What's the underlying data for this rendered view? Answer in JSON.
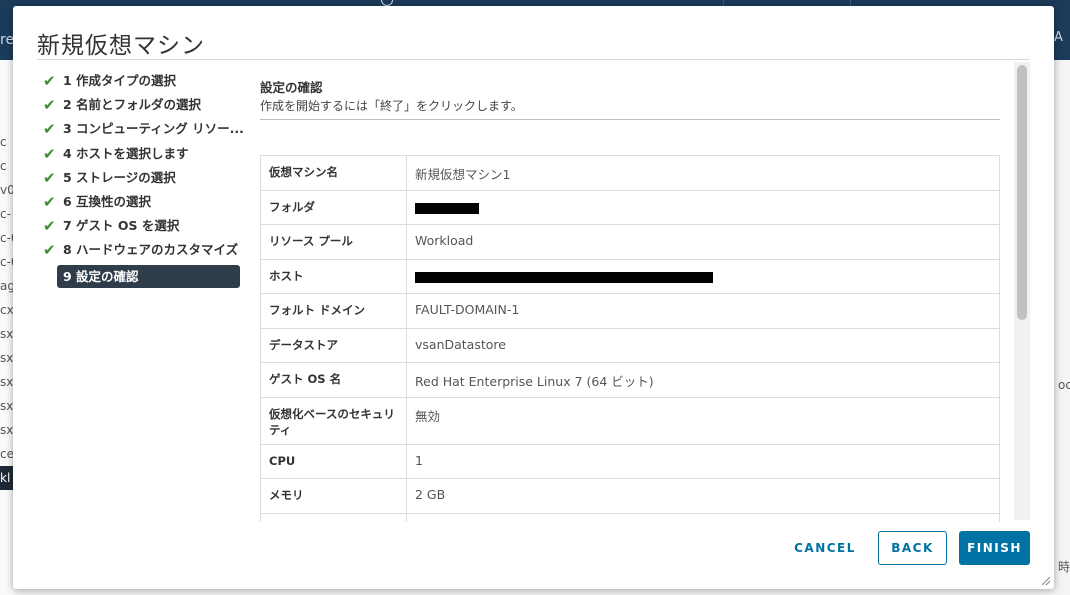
{
  "background": {
    "header_partial_left": "re",
    "header_partial_right": "A",
    "left_partial_items": [
      "c",
      "c",
      "v0",
      "c-",
      "c-0",
      "c-0",
      "ag",
      "cx",
      "sx",
      "sx",
      "sx",
      "sx",
      "sx",
      "ce",
      "kl"
    ],
    "right_partial_text": "oc",
    "right_bottom_partial_text": "時"
  },
  "modal": {
    "title": "新規仮想マシン",
    "steps": [
      {
        "label": "1 作成タイプの選択",
        "done": true
      },
      {
        "label": "2 名前とフォルダの選択",
        "done": true
      },
      {
        "label": "3 コンピューティング リソー...",
        "done": true
      },
      {
        "label": "4 ホストを選択します",
        "done": true
      },
      {
        "label": "5 ストレージの選択",
        "done": true
      },
      {
        "label": "6 互換性の選択",
        "done": true
      },
      {
        "label": "7 ゲスト OS を選択",
        "done": true
      },
      {
        "label": "8 ハードウェアのカスタマイズ",
        "done": true
      },
      {
        "label": "9 設定の確認",
        "done": false,
        "active": true
      }
    ],
    "content": {
      "title": "設定の確認",
      "description": "作成を開始するには「終了」をクリックします。",
      "rows": [
        {
          "key": "仮想マシン名",
          "value": "新規仮想マシン1"
        },
        {
          "key": "フォルダ",
          "value": "",
          "redacted": true
        },
        {
          "key": "リソース プール",
          "value": "Workload"
        },
        {
          "key": "ホスト",
          "value": "",
          "redacted": true
        },
        {
          "key": "フォルト ドメイン",
          "value": "FAULT-DOMAIN-1"
        },
        {
          "key": "データストア",
          "value": "vsanDatastore"
        },
        {
          "key": "ゲスト OS 名",
          "value": "Red Hat Enterprise Linux 7 (64 ビット)"
        },
        {
          "key": "仮想化ベースのセキュリティ",
          "value": "無効"
        },
        {
          "key": "CPU",
          "value": "1"
        },
        {
          "key": "メモリ",
          "value": "2 GB"
        }
      ]
    },
    "buttons": {
      "cancel": "CANCEL",
      "back": "BACK",
      "finish": "FINISH"
    }
  },
  "colors": {
    "accent": "#0072a3",
    "check": "#3c8f2f",
    "active_step_bg": "#2f3d4b",
    "header_bg": "#1b3b5a"
  }
}
